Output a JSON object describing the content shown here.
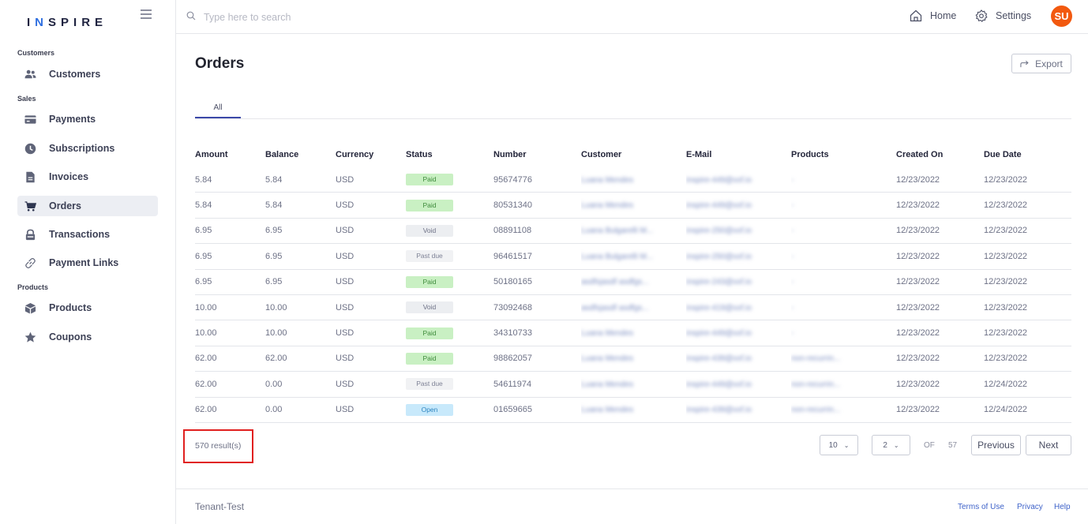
{
  "app": {
    "logo_a": "I",
    "logo_n": "N",
    "logo_b": "SPIRE"
  },
  "sidebar": {
    "sections": [
      {
        "label": "Customers"
      },
      {
        "label": "Sales"
      },
      {
        "label": "Products"
      }
    ],
    "items": [
      {
        "label": "Customers",
        "icon": "users-icon"
      },
      {
        "label": "Payments",
        "icon": "credit-card-icon"
      },
      {
        "label": "Subscriptions",
        "icon": "clock-icon"
      },
      {
        "label": "Invoices",
        "icon": "document-icon"
      },
      {
        "label": "Orders",
        "icon": "cart-icon",
        "active": true
      },
      {
        "label": "Transactions",
        "icon": "lock-icon"
      },
      {
        "label": "Payment Links",
        "icon": "link-icon"
      },
      {
        "label": "Products",
        "icon": "box-icon"
      },
      {
        "label": "Coupons",
        "icon": "star-icon"
      }
    ]
  },
  "topbar": {
    "search_placeholder": "Type here to search",
    "home_label": "Home",
    "settings_label": "Settings",
    "avatar_initials": "SU",
    "avatar_color": "#f2590f"
  },
  "page": {
    "title": "Orders",
    "export_label": "Export",
    "tabs": [
      {
        "label": "All"
      }
    ]
  },
  "table": {
    "columns": [
      "Amount",
      "Balance",
      "Currency",
      "Status",
      "Number",
      "Customer",
      "E-Mail",
      "Products",
      "Created On",
      "Due Date"
    ],
    "rows": [
      {
        "amount": "5.84",
        "balance": "5.84",
        "currency": "USD",
        "status": "Paid",
        "number": "95674776",
        "customer": "Luana Mendes",
        "email": "inspire-449@xxf.io",
        "products": "-",
        "created": "12/23/2022",
        "due": "12/23/2022"
      },
      {
        "amount": "5.84",
        "balance": "5.84",
        "currency": "USD",
        "status": "Paid",
        "number": "80531340",
        "customer": "Luana Mendes",
        "email": "inspire-449@xxf.io",
        "products": "-",
        "created": "12/23/2022",
        "due": "12/23/2022"
      },
      {
        "amount": "6.95",
        "balance": "6.95",
        "currency": "USD",
        "status": "Void",
        "number": "08891108",
        "customer": "Luana Bulgarelli M...",
        "email": "inspire-250@xxf.io",
        "products": "-",
        "created": "12/23/2022",
        "due": "12/23/2022"
      },
      {
        "amount": "6.95",
        "balance": "6.95",
        "currency": "USD",
        "status": "Past due",
        "number": "96461517",
        "customer": "Luana Bulgarelli M...",
        "email": "inspire-250@xxf.io",
        "products": "-",
        "created": "12/23/2022",
        "due": "12/23/2022"
      },
      {
        "amount": "6.95",
        "balance": "6.95",
        "currency": "USD",
        "status": "Paid",
        "number": "50180165",
        "customer": "asdfsjasdf asdfgs...",
        "email": "inspire-243@xxf.io",
        "products": "-",
        "created": "12/23/2022",
        "due": "12/23/2022"
      },
      {
        "amount": "10.00",
        "balance": "10.00",
        "currency": "USD",
        "status": "Void",
        "number": "73092468",
        "customer": "asdfsjasdf asdfgs...",
        "email": "inspire-419@xxf.io",
        "products": "-",
        "created": "12/23/2022",
        "due": "12/23/2022"
      },
      {
        "amount": "10.00",
        "balance": "10.00",
        "currency": "USD",
        "status": "Paid",
        "number": "34310733",
        "customer": "Luana Mendes",
        "email": "inspire-449@xxf.io",
        "products": "-",
        "created": "12/23/2022",
        "due": "12/23/2022"
      },
      {
        "amount": "62.00",
        "balance": "62.00",
        "currency": "USD",
        "status": "Paid",
        "number": "98862057",
        "customer": "Luana Mendes",
        "email": "inspire-439@xxf.io",
        "products": "non-recurrin...",
        "created": "12/23/2022",
        "due": "12/23/2022"
      },
      {
        "amount": "62.00",
        "balance": "0.00",
        "currency": "USD",
        "status": "Past due",
        "number": "54611974",
        "customer": "Luana Mendes",
        "email": "inspire-449@xxf.io",
        "products": "non-recurrin...",
        "created": "12/23/2022",
        "due": "12/24/2022"
      },
      {
        "amount": "62.00",
        "balance": "0.00",
        "currency": "USD",
        "status": "Open",
        "number": "01659665",
        "customer": "Luana Mendes",
        "email": "inspire-439@xxf.io",
        "products": "non-recurrin...",
        "created": "12/23/2022",
        "due": "12/24/2022"
      }
    ]
  },
  "status_colors": {
    "Paid": {
      "bg": "#c9f0c3",
      "fg": "#3d8a3a"
    },
    "Void": {
      "bg": "#eceef1",
      "fg": "#6d7186"
    },
    "Past due": {
      "bg": "#f1f2f4",
      "fg": "#7e8296"
    },
    "Open": {
      "bg": "#c8e9fb",
      "fg": "#2e86c1"
    }
  },
  "pagination": {
    "results": "570 result(s)",
    "page_size": "10",
    "current_page": "2",
    "of_label": "OF",
    "total_pages": "57",
    "previous_label": "Previous",
    "next_label": "Next"
  },
  "footer": {
    "tenant": "Tenant-Test",
    "terms": "Terms of Use",
    "privacy": "Privacy",
    "help": "Help"
  }
}
